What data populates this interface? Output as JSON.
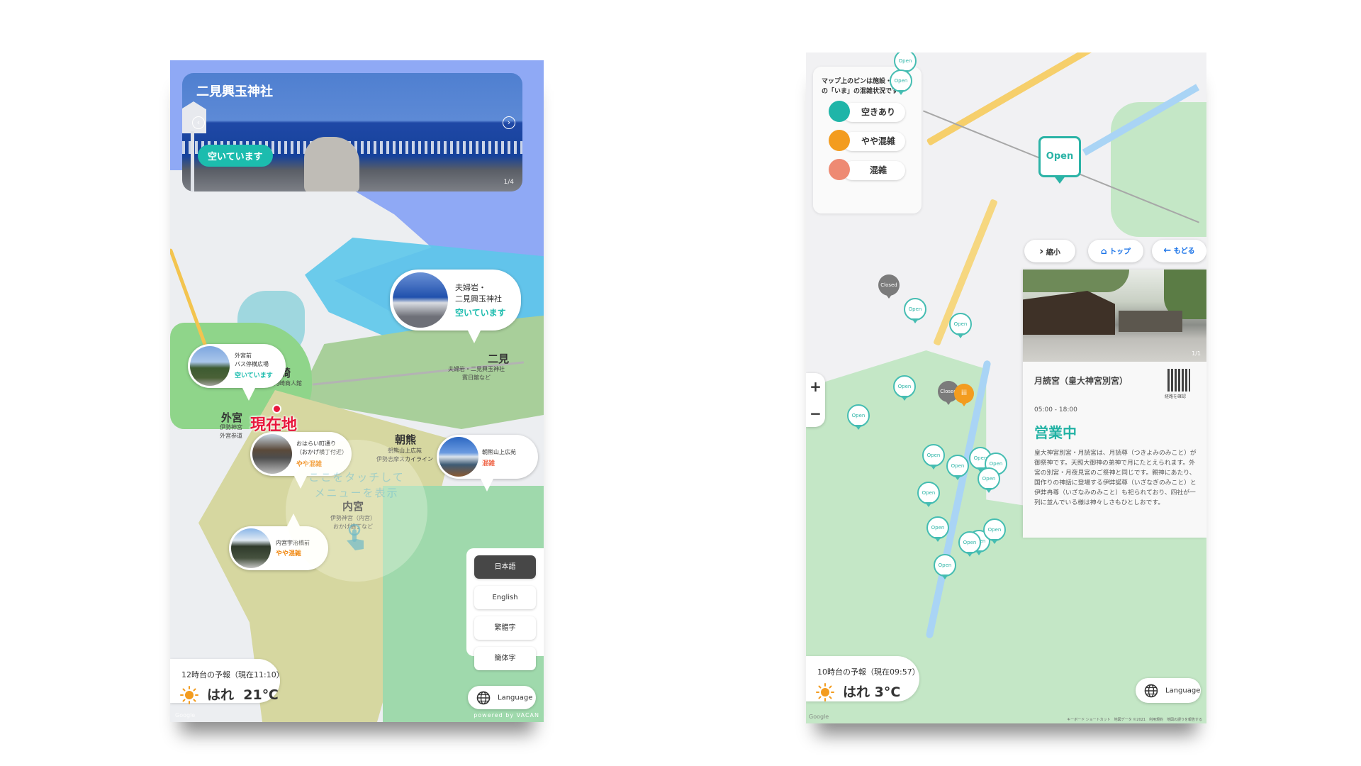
{
  "left_kiosk": {
    "hero_card": {
      "title": "二見興玉神社",
      "status_badge": "空いています",
      "prev_icon": "‹",
      "next_icon": "›",
      "page_indicator": "1/4"
    },
    "bubbles": [
      {
        "name_lines": [
          "夫婦岩・",
          "二見興玉神社"
        ],
        "status": "空いています",
        "status_color": "#1cbcae"
      },
      {
        "name_lines": [
          "外宮前",
          "バス停横広場"
        ],
        "status": "空いています",
        "status_color": "#1cbcae"
      },
      {
        "name_lines": [
          "おはらい町通り",
          "（おかげ横丁付近）"
        ],
        "status": "やや混雑",
        "status_color": "#f0860e"
      },
      {
        "name_lines": [
          "朝熊山上広苑"
        ],
        "status": "混雑",
        "status_color": "#f06a4d"
      },
      {
        "name_lines": [
          "内宮宇治橋前"
        ],
        "status": "やや混雑",
        "status_color": "#f0860e"
      }
    ],
    "areas": [
      {
        "title": "二見",
        "sub": [
          "夫婦岩・二見興玉神社",
          "賓日館など"
        ]
      },
      {
        "title": "河崎",
        "sub": [
          "伊勢河崎商人館"
        ]
      },
      {
        "title": "外宮",
        "sub": [
          "伊勢神宮",
          "外宮参道"
        ]
      },
      {
        "title": "朝熊",
        "sub": [
          "朝熊山上広苑",
          "伊勢志摩スカイライン"
        ]
      },
      {
        "title": "内宮",
        "sub": [
          "伊勢神宮（内宮）",
          "おかげ横丁など"
        ]
      }
    ],
    "current_location_label": "現在地",
    "touch_prompt": [
      "ここをタッチして",
      "メニューを表示"
    ],
    "languages": [
      {
        "label": "日本語",
        "active": true
      },
      {
        "label": "English",
        "active": false
      },
      {
        "label": "繁體字",
        "active": false
      },
      {
        "label": "簡体字",
        "active": false
      }
    ],
    "language_button": "Language",
    "weather": {
      "forecast_label": "12時台の予報（現在11:10）",
      "condition": "はれ",
      "temperature": "21℃"
    },
    "google_mark": "Google",
    "powered_by": "powered by VACAN"
  },
  "right_kiosk": {
    "legend": {
      "description": [
        "マップ上のピンは施設・お店",
        "の「いま」の混雑状況です"
      ],
      "items": [
        {
          "label": "空きあり",
          "color": "#1fb5a8"
        },
        {
          "label": "やや混雑",
          "color": "#f39c1f"
        },
        {
          "label": "混雑",
          "color": "#ee8a73"
        }
      ]
    },
    "selected_pin_label": "Open",
    "pin_open_label": "Open",
    "pin_closed_label": "Closed",
    "nav_buttons": {
      "shrink": "縮小",
      "top": "トップ",
      "back": "もどる"
    },
    "zoom": {
      "in": "+",
      "out": "−"
    },
    "detail": {
      "photo_count": "1/1",
      "title": "月読宮（皇大神宮別宮）",
      "qr_label": "経路を確認",
      "hours": "05:00 - 18:00",
      "open_status": "営業中",
      "description": "皇大神宮別宮・月読宮は、月読尊（つきよみのみこと）が御祭神です。天照大御神の弟神で月にたとえられます。外宮の別宮・月夜見宮のご祭神と同じです。親神にあたり、国作りの神話に登場する伊弉諾尊（いざなぎのみこと）と伊弉冉尊（いざなみのみこと）も祀られており、四社が一列に並んでいる様は神々しさもひとしおです。"
    },
    "weather": {
      "forecast_label": "10時台の予報（現在09:57）",
      "condition": "はれ",
      "temperature": "3°C"
    },
    "language_button": "Language",
    "google_mark": "Google",
    "map_attribution": "キーボード ショートカット　地図データ ©2021　利用規約　地図の誤りを報告する"
  }
}
